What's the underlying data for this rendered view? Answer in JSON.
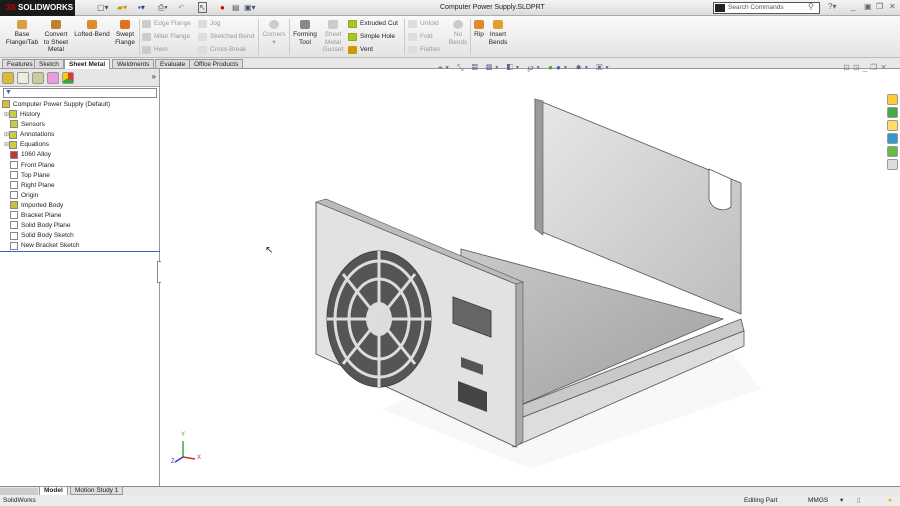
{
  "app": {
    "name": "SOLIDWORKS",
    "doc_title": "Computer Power Supply.SLDPRT",
    "search_placeholder": "Search Commands"
  },
  "ribbon": {
    "big": [
      {
        "label": "Base Flange/Tab"
      },
      {
        "label": "Convert to Sheet Metal"
      },
      {
        "label": "Lofted-Bend"
      },
      {
        "label": "Swept Flange"
      }
    ],
    "col1": [
      {
        "label": "Edge Flange"
      },
      {
        "label": "Miter Flange"
      },
      {
        "label": "Hem"
      }
    ],
    "col2": [
      {
        "label": "Jog"
      },
      {
        "label": "Sketched Bend"
      },
      {
        "label": "Cross-Break"
      }
    ],
    "corners": "Corners",
    "forming": "Forming Tool",
    "gusset": "Sheet Metal Gusset",
    "col3": [
      {
        "label": "Extruded Cut"
      },
      {
        "label": "Simple Hole"
      },
      {
        "label": "Vent"
      }
    ],
    "col4": [
      {
        "label": "Unfold"
      },
      {
        "label": "Fold"
      },
      {
        "label": "Flatten"
      }
    ],
    "no_bends": "No Bends",
    "rip": "Rip",
    "insert_bends": "Insert Bends"
  },
  "tabs": [
    "Features",
    "Sketch",
    "Sheet Metal",
    "Weldments",
    "Evaluate",
    "Office Products"
  ],
  "tree": {
    "root": "Computer Power Supply  (Default)",
    "items": [
      "History",
      "Sensors",
      "Annotations",
      "Equations",
      "1060 Alloy",
      "Front Plane",
      "Top Plane",
      "Right Plane",
      "Origin",
      "Imported Body",
      "Bracket Plane",
      "Solid Body Plane",
      "Solid Body Sketch",
      "New Bracket Sketch"
    ]
  },
  "bottom_tabs": [
    "Model",
    "Motion Study 1"
  ],
  "status": {
    "app": "SolidWorks",
    "mode": "Editing Part",
    "units": "MMGS"
  },
  "axes": {
    "x": "X",
    "y": "Y",
    "z": "Z"
  }
}
